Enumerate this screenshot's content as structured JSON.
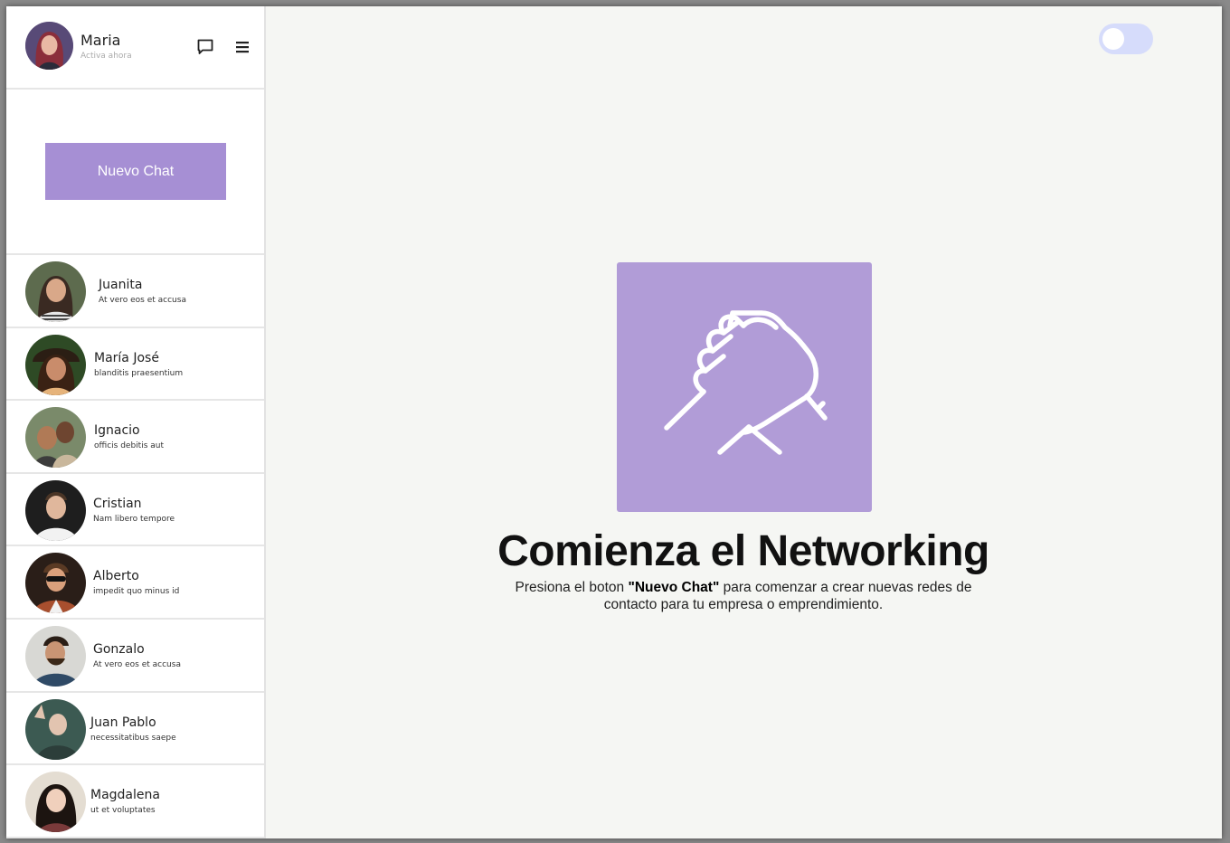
{
  "user": {
    "name": "Maria",
    "status": "Activa ahora"
  },
  "header": {
    "chat_icon": "chat-bubble-icon",
    "menu_icon": "hamburger-menu-icon"
  },
  "new_chat": {
    "label": "Nuevo Chat"
  },
  "contacts": [
    {
      "name": "Juanita",
      "message": "At vero eos et accusa"
    },
    {
      "name": "María José",
      "message": "blanditis praesentium"
    },
    {
      "name": "Ignacio",
      "message": "officis debitis aut"
    },
    {
      "name": "Cristian",
      "message": "Nam libero tempore"
    },
    {
      "name": "Alberto",
      "message": "impedit quo minus id"
    },
    {
      "name": "Gonzalo",
      "message": "At vero eos et accusa"
    },
    {
      "name": "Juan Pablo",
      "message": "necessitatibus saepe"
    },
    {
      "name": "Magdalena",
      "message": "ut et voluptates"
    }
  ],
  "hero": {
    "icon": "handshake-icon",
    "title": "Comienza el Networking",
    "desc_before": "Presiona el boton ",
    "desc_bold": "\"Nuevo Chat\"",
    "desc_after": " para comenzar a crear nuevas redes de contacto para tu empresa o emprendimiento."
  },
  "colors": {
    "accent": "#a68fd4",
    "hero_bg": "#b19cd7",
    "toggle_bg": "#d6dcfb",
    "main_bg": "#f5f6f3"
  }
}
